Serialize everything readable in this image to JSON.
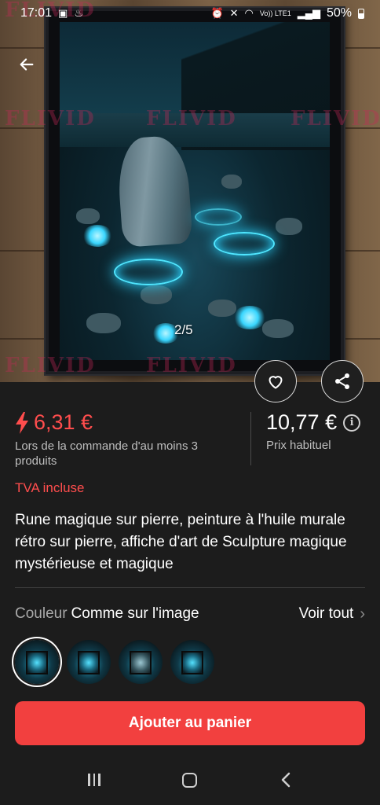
{
  "status_bar": {
    "time": "17:01",
    "network_label": "Vo)) LTE1",
    "battery_percent": "50%"
  },
  "watermark": "FLIVID",
  "gallery": {
    "counter": "2/5"
  },
  "price": {
    "sale_price": "6,31 €",
    "sale_note": "Lors de la commande d'au moins 3 produits",
    "regular_price": "10,77 €",
    "regular_note": "Prix habituel",
    "accent_color": "#ff4d4d"
  },
  "vat_label": "TVA incluse",
  "product_title": "Rune magique sur pierre, peinture à l'huile murale rétro sur pierre, affiche d'art de Sculpture magique mystérieuse et magique",
  "variant": {
    "label": "Couleur",
    "value": "Comme sur l'image",
    "see_all": "Voir tout",
    "thumbnails": [
      "variant-1",
      "variant-2",
      "variant-3",
      "variant-4"
    ],
    "selected_index": 0
  },
  "cta": {
    "add_to_cart": "Ajouter au panier",
    "color": "#f2403f"
  },
  "icons": {
    "back": "arrow-left-icon",
    "favorite": "heart-icon",
    "share": "share-icon",
    "info": "info-icon"
  }
}
